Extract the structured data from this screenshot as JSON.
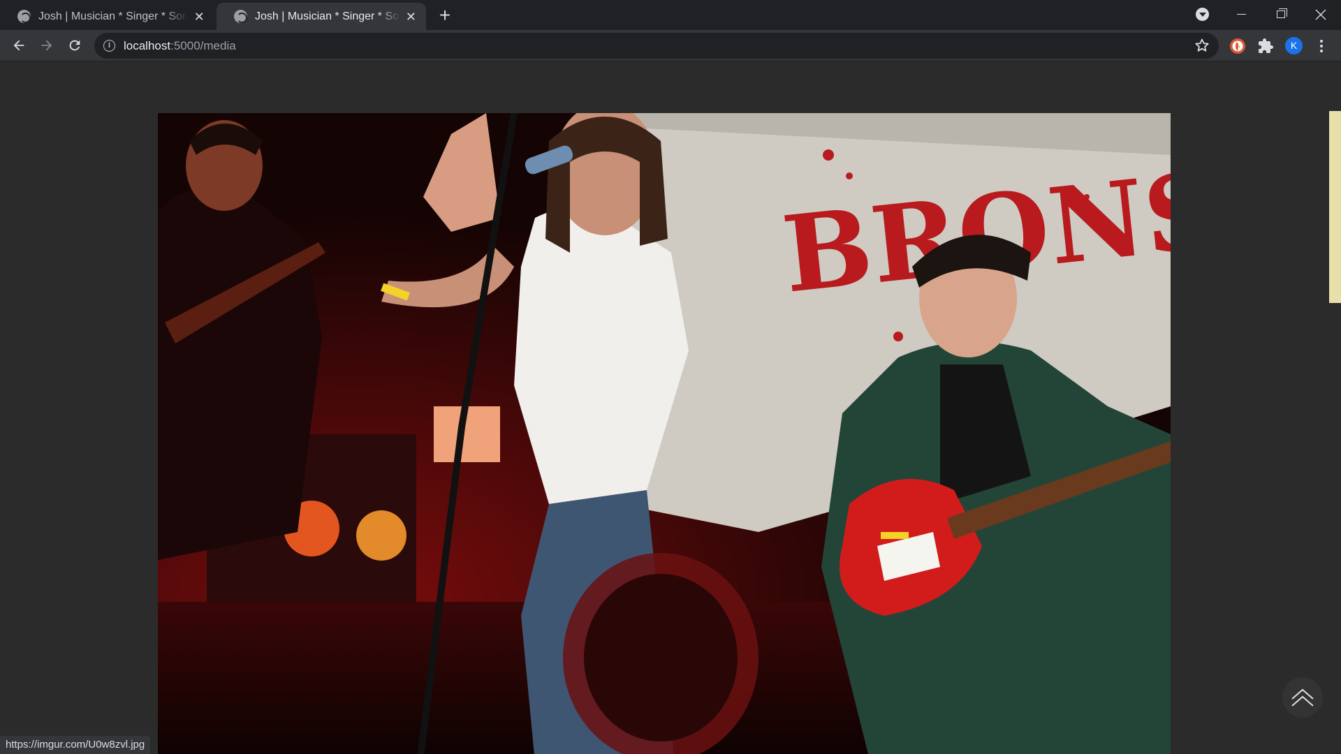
{
  "browser": {
    "tabs": [
      {
        "title": "Josh | Musician * Singer * Songwriter",
        "active": false
      },
      {
        "title": "Josh | Musician * Singer * Songwriter",
        "active": true
      }
    ],
    "new_tab_symbol": "+",
    "close_symbol": "✕",
    "address": {
      "host": "localhost",
      "path": ":5000/media"
    },
    "profile_initial": "K"
  },
  "page": {
    "background": "#2b2b2b",
    "photo_description_colors": {
      "stage_red": "#c51a1a",
      "banner": "#d6d2c9",
      "shirt_white": "#f3f1ee"
    }
  },
  "status_url": "https://imgur.com/U0w8zvl.jpg",
  "icons": {
    "back": "arrow-left-icon",
    "forward": "arrow-right-icon",
    "reload": "reload-icon",
    "info": "info-icon",
    "star": "star-icon",
    "ext1": "duckduckgo-icon",
    "ext2": "puzzle-icon",
    "menu": "kebab-menu-icon",
    "scroll_top": "chevron-double-up-icon"
  }
}
